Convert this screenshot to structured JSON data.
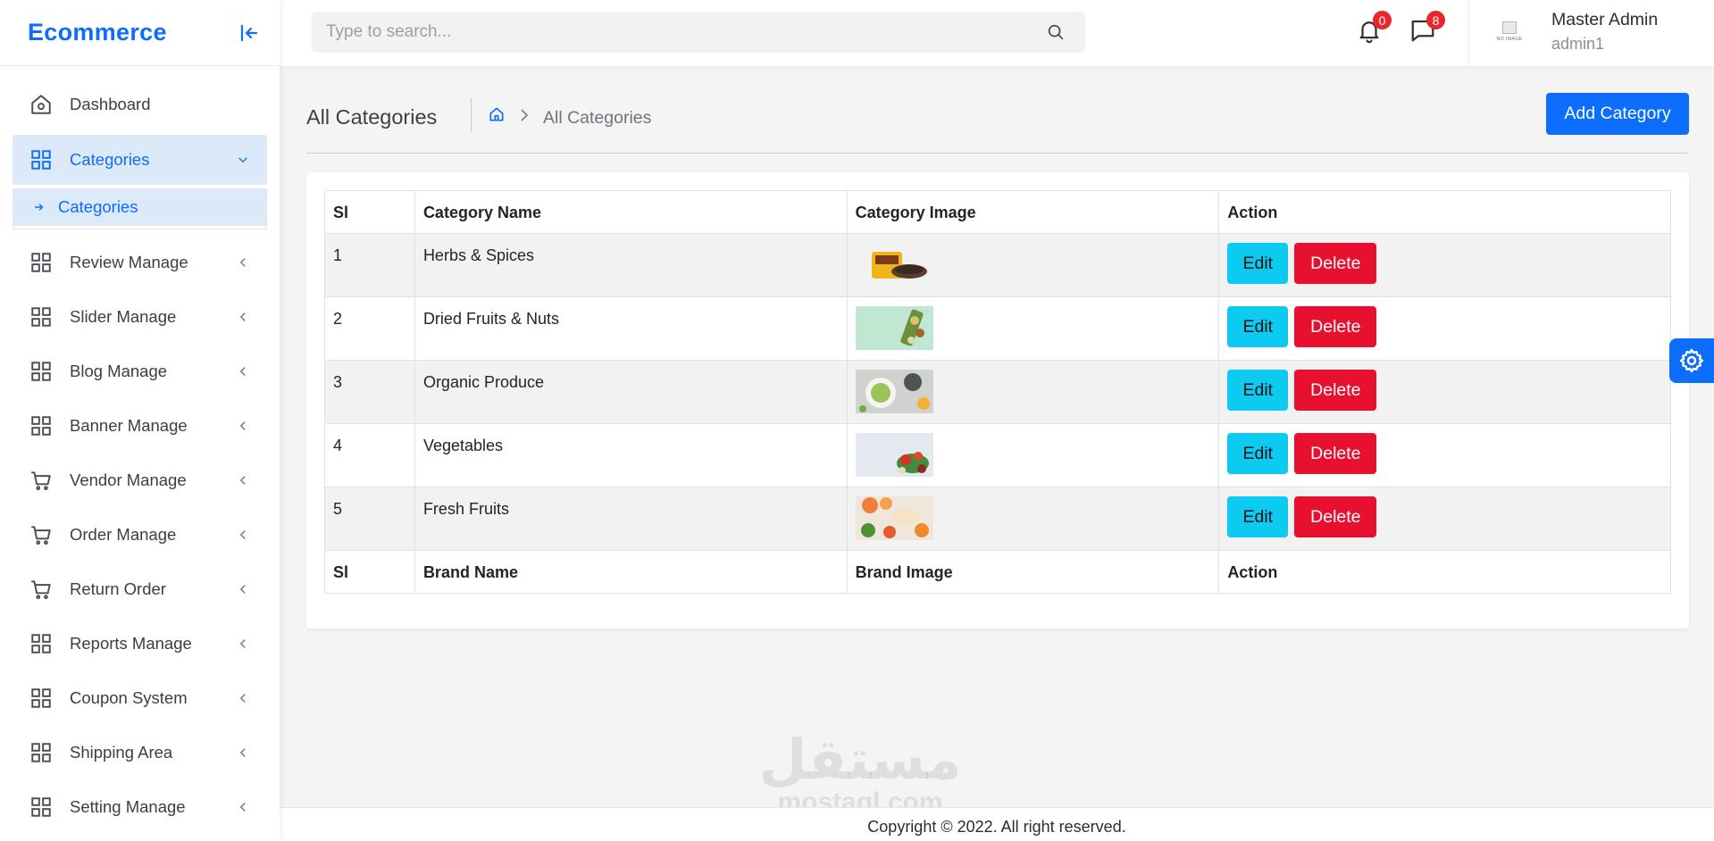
{
  "sidebar": {
    "brand": "Ecommerce",
    "menu": {
      "dashboard": "Dashboard",
      "categories": "Categories",
      "categories_sub": "Categories",
      "review": "Review Manage",
      "slider": "Slider Manage",
      "blog": "Blog Manage",
      "banner": "Banner Manage",
      "vendor": "Vendor Manage",
      "order": "Order Manage",
      "return_order": "Return Order",
      "reports": "Reports Manage",
      "coupon": "Coupon System",
      "shipping": "Shipping Area",
      "setting": "Setting Manage"
    }
  },
  "topbar": {
    "search_placeholder": "Type to search...",
    "notifications_count": "0",
    "messages_count": "8",
    "avatar_text": "NO IMAGE",
    "user_name": "Master Admin",
    "user_handle": "admin1"
  },
  "page": {
    "title": "All Categories",
    "breadcrumb_current": "All Categories",
    "add_button": "Add Category"
  },
  "table": {
    "headers": {
      "sl": "Sl",
      "name": "Category Name",
      "image": "Category Image",
      "action": "Action"
    },
    "rows": [
      {
        "sl": "1",
        "name": "Herbs & Spices"
      },
      {
        "sl": "2",
        "name": "Dried Fruits & Nuts"
      },
      {
        "sl": "3",
        "name": "Organic Produce"
      },
      {
        "sl": "4",
        "name": "Vegetables"
      },
      {
        "sl": "5",
        "name": "Fresh Fruits"
      }
    ],
    "edit_label": "Edit",
    "delete_label": "Delete",
    "footer": {
      "sl": "Sl",
      "name": "Brand Name",
      "image": "Brand Image",
      "action": "Action"
    }
  },
  "watermark": {
    "arabic": "مستقل",
    "latin": "mostaql.com"
  },
  "footer": {
    "copyright": "Copyright © 2022. All right reserved."
  },
  "colors": {
    "primary": "#0d6efd",
    "edit": "#0dcaf0",
    "delete": "#e8102f",
    "badge": "#e8262c"
  }
}
